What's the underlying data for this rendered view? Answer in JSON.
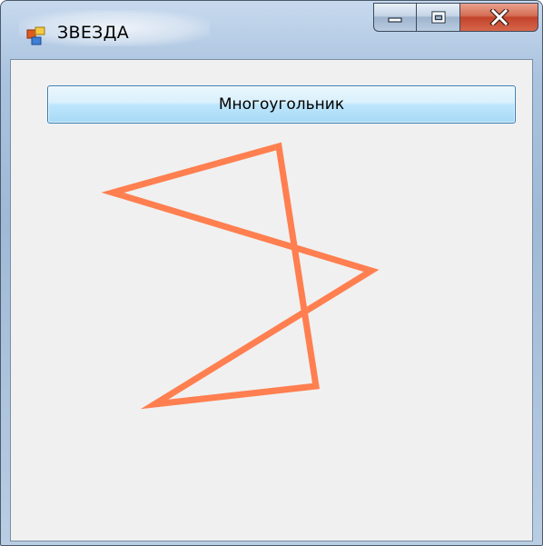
{
  "window": {
    "title": "ЗВЕЗДА",
    "icon": "app-form-icon"
  },
  "controls": {
    "minimize_icon": "minimize-icon",
    "maximize_icon": "maximize-icon",
    "close_icon": "close-icon",
    "close_color": "#c2432a"
  },
  "toolbar": {
    "polygon_button_label": "Многоугольник"
  },
  "canvas": {
    "shape": "pentagram",
    "stroke_color": "#ff7f50"
  }
}
